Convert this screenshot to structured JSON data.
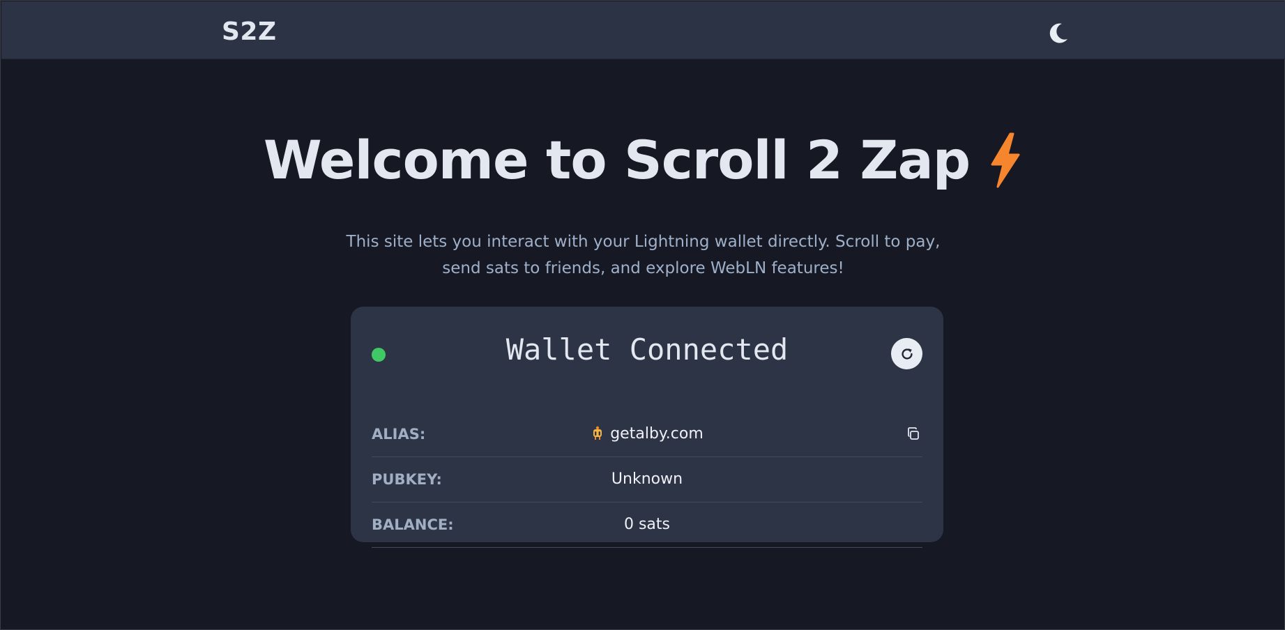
{
  "header": {
    "brand": "S2Z",
    "theme_icon": "moon-icon"
  },
  "hero": {
    "title": "Welcome to Scroll 2 Zap",
    "title_icon": "lightning-bolt-icon",
    "accent_color": "#f5862e",
    "subtitle": "This site lets you interact with your Lightning wallet directly. Scroll to pay, send sats to friends, and explore WebLN features!"
  },
  "wallet": {
    "title": "Wallet Connected",
    "status_color": "#40c866",
    "refresh_icon": "refresh-icon",
    "rows": [
      {
        "label": "ALIAS:",
        "value": "getalby.com",
        "icon": "alby-icon",
        "action_icon": "copy-icon"
      },
      {
        "label": "PUBKEY:",
        "value": "Unknown"
      },
      {
        "label": "BALANCE:",
        "value": "0 sats"
      }
    ]
  }
}
